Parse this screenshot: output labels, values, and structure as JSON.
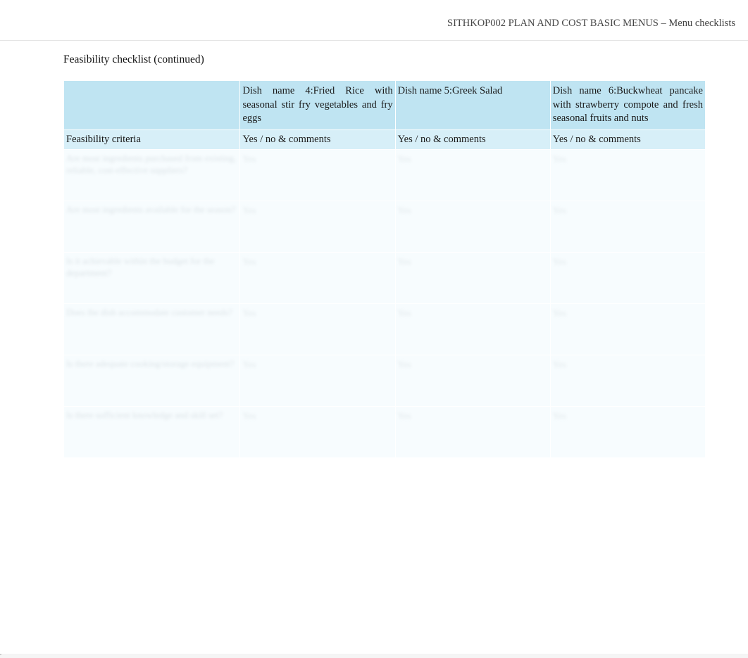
{
  "header": {
    "breadcrumb": "SITHKOP002 PLAN AND COST BASIC MENUS – Menu checklists"
  },
  "title": "Feasibility checklist (continued)",
  "table": {
    "dishHeaders": {
      "empty": "",
      "dish4": "Dish name 4:Fried Rice with seasonal stir fry vegetables and fry eggs",
      "dish5": "Dish name 5:Greek Salad",
      "dish6": "Dish name 6:Buckwheat pancake with strawberry compote and fresh seasonal fruits and nuts"
    },
    "subHeaders": {
      "criteria": "Feasibility criteria",
      "col1": "Yes / no & comments",
      "col2": "Yes / no & comments",
      "col3": "Yes / no & comments"
    },
    "rows": [
      {
        "criteria": "Are most ingredients purchased from existing, reliable, cost-effective suppliers?",
        "a1": "Yes",
        "a2": "Yes",
        "a3": "Yes"
      },
      {
        "criteria": "Are most ingredients available for the season?",
        "a1": "Yes",
        "a2": "Yes",
        "a3": "Yes"
      },
      {
        "criteria": "Is it achievable within the budget for the department?",
        "a1": "Yes",
        "a2": "Yes",
        "a3": "Yes"
      },
      {
        "criteria": "Does the dish accommodate customer needs?",
        "a1": "Yes",
        "a2": "Yes",
        "a3": "Yes"
      },
      {
        "criteria": "Is there adequate cooking/storage equipment?",
        "a1": "Yes",
        "a2": "Yes",
        "a3": "Yes"
      },
      {
        "criteria": "Is there sufficient knowledge and skill set?",
        "a1": "Yes",
        "a2": "Yes",
        "a3": "Yes"
      }
    ]
  }
}
